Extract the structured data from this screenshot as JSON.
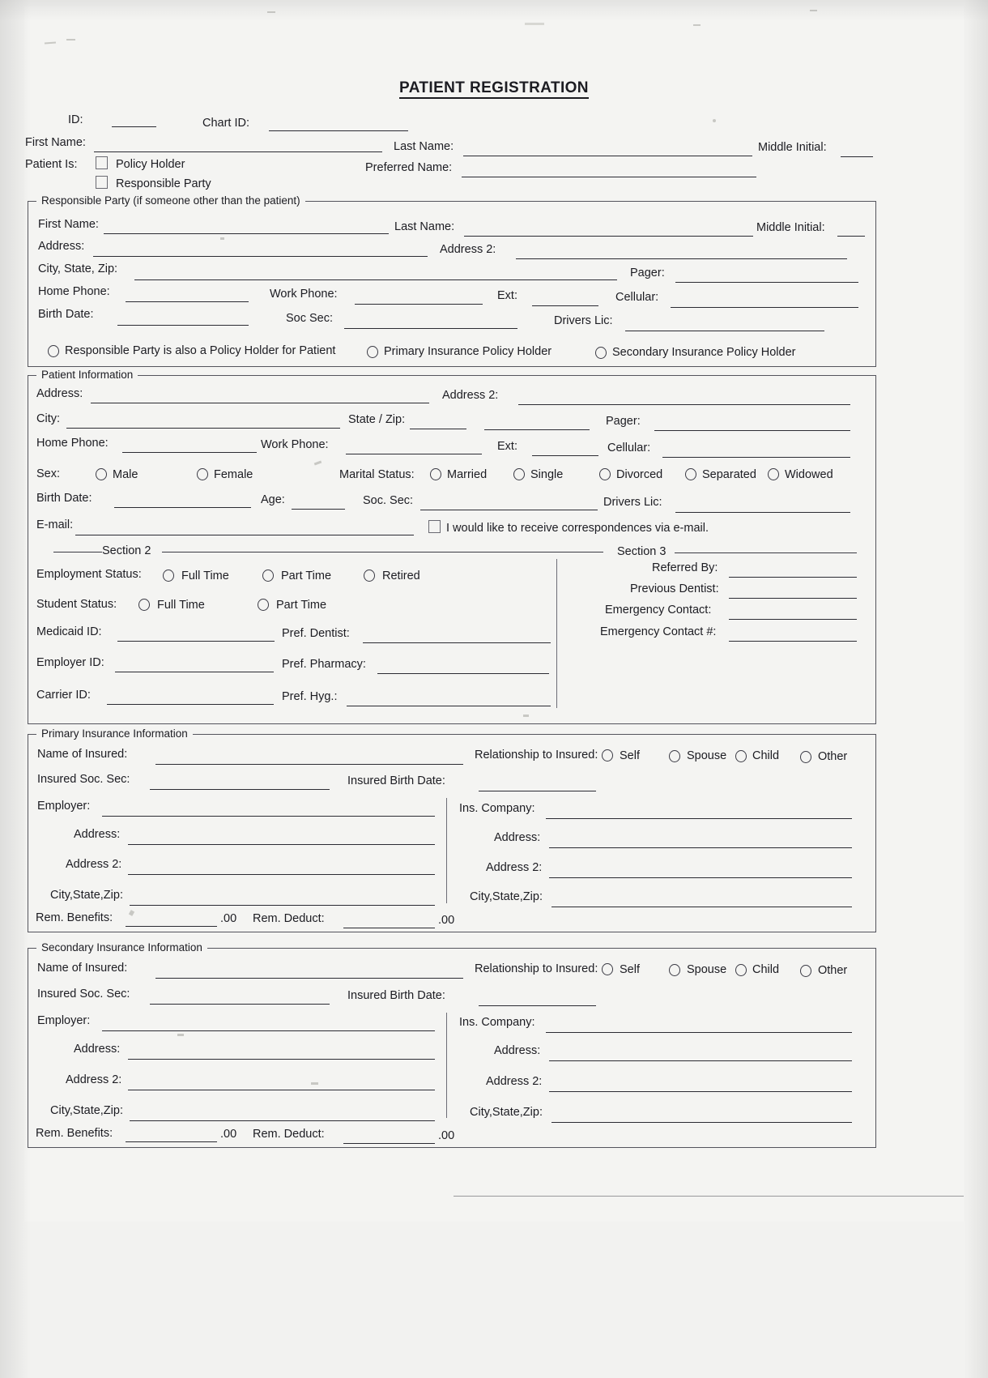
{
  "document": {
    "title": "PATIENT REGISTRATION"
  },
  "header": {
    "id_label": "ID:",
    "chart_id_label": "Chart ID:",
    "first_name_label": "First Name:",
    "last_name_label": "Last Name:",
    "middle_initial_label": "Middle Initial:",
    "patient_is_label": "Patient Is:",
    "policy_holder_label": "Policy Holder",
    "responsible_party_label": "Responsible Party",
    "preferred_name_label": "Preferred Name:"
  },
  "responsible_party": {
    "legend": "Responsible Party (if someone other than the patient)",
    "first_name_label": "First Name:",
    "last_name_label": "Last Name:",
    "middle_initial_label": "Middle Initial:",
    "address_label": "Address:",
    "address2_label": "Address 2:",
    "city_state_zip_label": "City, State, Zip:",
    "pager_label": "Pager:",
    "home_phone_label": "Home Phone:",
    "work_phone_label": "Work Phone:",
    "ext_label": "Ext:",
    "cellular_label": "Cellular:",
    "birth_date_label": "Birth Date:",
    "soc_sec_label": "Soc Sec:",
    "drivers_lic_label": "Drivers Lic:",
    "options": [
      "Responsible Party is also a Policy Holder for Patient",
      "Primary Insurance Policy Holder",
      "Secondary Insurance Policy Holder"
    ]
  },
  "patient_information": {
    "legend": "Patient Information",
    "address_label": "Address:",
    "address2_label": "Address 2:",
    "city_label": "City:",
    "state_zip_label": "State / Zip:",
    "pager_label": "Pager:",
    "home_phone_label": "Home Phone:",
    "work_phone_label": "Work Phone:",
    "ext_label": "Ext:",
    "cellular_label": "Cellular:",
    "sex_label": "Sex:",
    "sex_options": [
      "Male",
      "Female"
    ],
    "marital_status_label": "Marital Status:",
    "marital_options": [
      "Married",
      "Single",
      "Divorced",
      "Separated",
      "Widowed"
    ],
    "birth_date_label": "Birth Date:",
    "age_label": "Age:",
    "soc_sec_label": "Soc. Sec:",
    "drivers_lic_label": "Drivers Lic:",
    "email_label": "E-mail:",
    "email_optin_label": "I would like to receive correspondences via e-mail.",
    "section2_label": "Section 2",
    "section3_label": "Section 3",
    "employment_status_label": "Employment Status:",
    "employment_options": [
      "Full Time",
      "Part Time",
      "Retired"
    ],
    "student_status_label": "Student Status:",
    "student_options": [
      "Full Time",
      "Part Time"
    ],
    "medicaid_id_label": "Medicaid ID:",
    "pref_dentist_label": "Pref. Dentist:",
    "employer_id_label": "Employer ID:",
    "pref_pharmacy_label": "Pref. Pharmacy:",
    "carrier_id_label": "Carrier ID:",
    "pref_hyg_label": "Pref. Hyg.:",
    "referred_by_label": "Referred By:",
    "previous_dentist_label": "Previous Dentist:",
    "emergency_contact_label": "Emergency Contact:",
    "emergency_contact_number_label": "Emergency Contact #:"
  },
  "primary_insurance": {
    "legend": "Primary Insurance Information",
    "name_of_insured_label": "Name of Insured:",
    "relationship_label": "Relationship to Insured:",
    "relationship_options": [
      "Self",
      "Spouse",
      "Child",
      "Other"
    ],
    "insured_soc_sec_label": "Insured Soc. Sec:",
    "insured_birth_date_label": "Insured Birth Date:",
    "employer_label": "Employer:",
    "ins_company_label": "Ins. Company:",
    "address_label": "Address:",
    "address2_label": "Address 2:",
    "city_state_zip_label": "City,State,Zip:",
    "rem_benefits_label": "Rem. Benefits:",
    "rem_benefits_cents": ".00",
    "rem_deduct_label": "Rem. Deduct:",
    "rem_deduct_cents": ".00"
  },
  "secondary_insurance": {
    "legend": "Secondary Insurance Information",
    "name_of_insured_label": "Name of Insured:",
    "relationship_label": "Relationship to Insured:",
    "relationship_options": [
      "Self",
      "Spouse",
      "Child",
      "Other"
    ],
    "insured_soc_sec_label": "Insured Soc. Sec:",
    "insured_birth_date_label": "Insured Birth Date:",
    "employer_label": "Employer:",
    "ins_company_label": "Ins. Company:",
    "address_label": "Address:",
    "address2_label": "Address 2:",
    "city_state_zip_label": "City,State,Zip:",
    "rem_benefits_label": "Rem. Benefits:",
    "rem_benefits_cents": ".00",
    "rem_deduct_label": "Rem. Deduct:",
    "rem_deduct_cents": ".00"
  },
  "colors": {
    "paper": "#f4f4f2",
    "ink": "#1c1c22",
    "rule": "#2b2b33",
    "border": "#54545c"
  }
}
